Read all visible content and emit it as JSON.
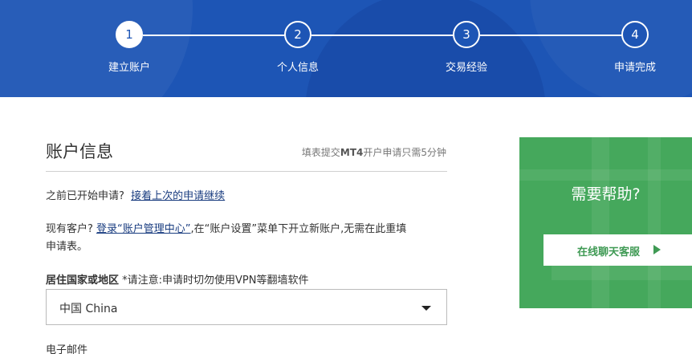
{
  "steps": [
    {
      "number": "1",
      "label": "建立账户",
      "active": true
    },
    {
      "number": "2",
      "label": "个人信息",
      "active": false
    },
    {
      "number": "3",
      "label": "交易经验",
      "active": false
    },
    {
      "number": "4",
      "label": "申请完成",
      "active": false
    }
  ],
  "form": {
    "title": "账户信息",
    "note_prefix": "填表提交",
    "note_bold": "MT4",
    "note_suffix": "开户申请只需5分钟",
    "resume_text": "之前已开始申请?",
    "resume_link": "接着上次的申请继续",
    "existing_prefix": "现有客户?",
    "existing_link": "登录“账户管理中心”",
    "existing_suffix_1": ",在“账户设置”菜单下开立新账户,无需在此重填",
    "existing_suffix_2": "申请表。",
    "country_label": "居住国家或地区",
    "country_note": "*请注意:申请时切勿使用VPN等翻墙软件",
    "country_value": "中国 China",
    "email_label": "电子邮件"
  },
  "help": {
    "title": "需要帮助?",
    "chat_label": "在线聊天客服"
  },
  "colors": {
    "header_blue": "#1d55b5",
    "help_green": "#45a85c",
    "link_blue": "#1a3d80"
  }
}
